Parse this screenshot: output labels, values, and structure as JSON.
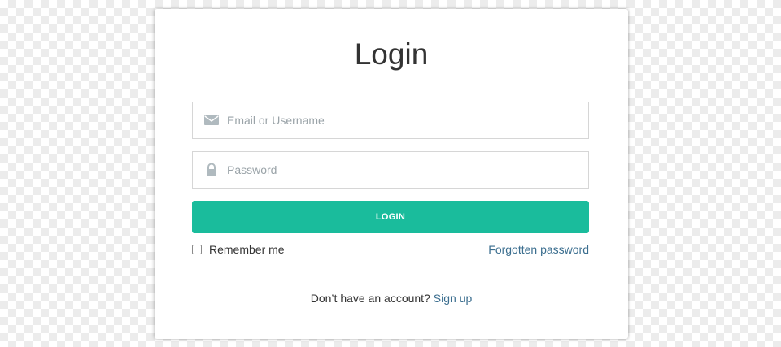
{
  "login": {
    "title": "Login",
    "email_placeholder": "Email or Username",
    "password_placeholder": "Password",
    "submit_label": "LOGIN",
    "remember_label": "Remember me",
    "remember_checked": false,
    "forgot_label": "Forgotten password",
    "signup_prompt": "Don’t have an account?",
    "signup_label": "Sign up"
  },
  "icons": {
    "email": "envelope-icon",
    "password": "lock-icon"
  },
  "colors": {
    "accent": "#1abc9c",
    "link": "#3b6e8f",
    "text": "#333333",
    "placeholder": "#9aa3a8",
    "icon": "#b0babf"
  }
}
